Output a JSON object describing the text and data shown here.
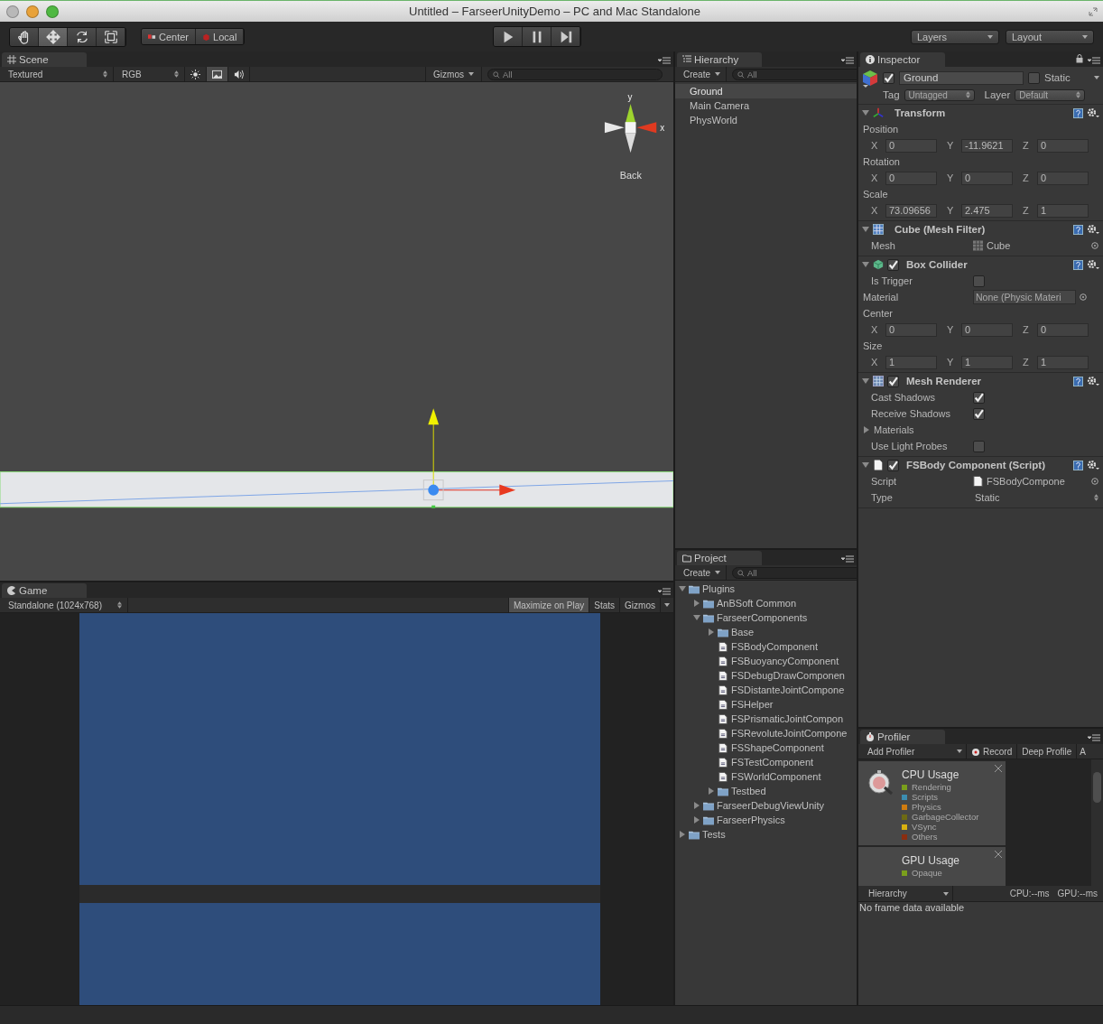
{
  "window": {
    "title": "Untitled – FarseerUnityDemo – PC and Mac Standalone"
  },
  "toolbar": {
    "tools": [
      {
        "kind": "hand",
        "selected": false
      },
      {
        "kind": "move",
        "selected": true
      },
      {
        "kind": "rotate",
        "selected": false
      },
      {
        "kind": "scale",
        "selected": false
      }
    ],
    "pivot": [
      {
        "kind": "center",
        "label": "Center"
      },
      {
        "kind": "local",
        "label": "Local"
      }
    ],
    "playback": [
      {
        "kind": "play"
      },
      {
        "kind": "pause"
      },
      {
        "kind": "step"
      }
    ],
    "layers": "Layers",
    "layout": "Layout"
  },
  "scene": {
    "tab": "Scene",
    "render_mode": "Textured",
    "color_mode": "RGB",
    "toggles": [
      {
        "kind": "lighting",
        "selected": false
      },
      {
        "kind": "image",
        "selected": true
      },
      {
        "kind": "audio",
        "selected": false
      }
    ],
    "gizmos": "Gizmos",
    "search": {
      "placeholder": "All"
    },
    "view_gizmo": {
      "y_label": "y",
      "x_label": "x",
      "view": "Back"
    }
  },
  "game": {
    "tab": "Game",
    "resolution": "Standalone (1024x768)",
    "buttons": [
      {
        "label": "Maximize on Play",
        "selected": true
      },
      {
        "label": "Stats",
        "selected": false
      },
      {
        "label": "Gizmos",
        "selected": false
      }
    ]
  },
  "hierarchy": {
    "tab": "Hierarchy",
    "create": "Create",
    "search": {
      "placeholder": "All"
    },
    "items": [
      {
        "label": "Ground",
        "selected": true
      },
      {
        "label": "Main Camera",
        "selected": false
      },
      {
        "label": "PhysWorld",
        "selected": false
      }
    ]
  },
  "inspector": {
    "tab": "Inspector",
    "object": {
      "name": "Ground",
      "active": true,
      "static": false,
      "static_label": "Static",
      "tag_label": "Tag",
      "tag": "Untagged",
      "layer_label": "Layer",
      "layer": "Default"
    },
    "components": [
      {
        "kind": "transform",
        "title": "Transform",
        "expanded": true,
        "rows": [
          {
            "kind": "heading",
            "label": "Position"
          },
          {
            "kind": "vector",
            "fields": [
              {
                "axis": "X",
                "value": "0"
              },
              {
                "axis": "Y",
                "value": "-11.9621"
              },
              {
                "axis": "Z",
                "value": "0"
              }
            ]
          },
          {
            "kind": "heading",
            "label": "Rotation"
          },
          {
            "kind": "vector",
            "fields": [
              {
                "axis": "X",
                "value": "0"
              },
              {
                "axis": "Y",
                "value": "0"
              },
              {
                "axis": "Z",
                "value": "0"
              }
            ]
          },
          {
            "kind": "heading",
            "label": "Scale"
          },
          {
            "kind": "vector",
            "fields": [
              {
                "axis": "X",
                "value": "73.09656"
              },
              {
                "axis": "Y",
                "value": "2.475"
              },
              {
                "axis": "Z",
                "value": "1"
              }
            ]
          }
        ]
      },
      {
        "kind": "mesh-filter",
        "title": "Cube (Mesh Filter)",
        "expanded": true,
        "rows": [
          {
            "kind": "mesh-ref",
            "label": "Mesh",
            "value": "Cube"
          }
        ]
      },
      {
        "kind": "box-collider",
        "title": "Box Collider",
        "enabled": true,
        "expanded": true,
        "rows": [
          {
            "kind": "toggle",
            "label": "Is Trigger",
            "checked": false
          },
          {
            "kind": "asset-field",
            "label": "Material",
            "value": "None (Physic Materi"
          },
          {
            "kind": "heading",
            "label": "Center"
          },
          {
            "kind": "vector",
            "fields": [
              {
                "axis": "X",
                "value": "0"
              },
              {
                "axis": "Y",
                "value": "0"
              },
              {
                "axis": "Z",
                "value": "0"
              }
            ]
          },
          {
            "kind": "heading",
            "label": "Size"
          },
          {
            "kind": "vector",
            "fields": [
              {
                "axis": "X",
                "value": "1"
              },
              {
                "axis": "Y",
                "value": "1"
              },
              {
                "axis": "Z",
                "value": "1"
              }
            ]
          }
        ]
      },
      {
        "kind": "mesh-renderer",
        "title": "Mesh Renderer",
        "enabled": true,
        "expanded": true,
        "rows": [
          {
            "kind": "toggle",
            "label": "Cast Shadows",
            "checked": true
          },
          {
            "kind": "toggle",
            "label": "Receive Shadows",
            "checked": true
          },
          {
            "kind": "foldout",
            "label": "Materials",
            "expanded": false
          },
          {
            "kind": "toggle",
            "label": "Use Light Probes",
            "checked": false
          }
        ]
      },
      {
        "kind": "script",
        "title": "FSBody Component (Script)",
        "enabled": true,
        "expanded": true,
        "rows": [
          {
            "kind": "script-ref",
            "label": "Script",
            "value": "FSBodyCompone"
          },
          {
            "kind": "enum",
            "label": "Type",
            "value": "Static"
          }
        ]
      }
    ]
  },
  "project": {
    "tab": "Project",
    "create": "Create",
    "search": {
      "placeholder": "All"
    },
    "tree": [
      {
        "kind": "folder",
        "label": "Plugins",
        "expanded": true,
        "children": [
          {
            "kind": "folder",
            "label": "AnBSoft Common",
            "expanded": false
          },
          {
            "kind": "folder",
            "label": "FarseerComponents",
            "expanded": true,
            "children": [
              {
                "kind": "folder",
                "label": "Base",
                "expanded": false
              },
              {
                "kind": "script",
                "label": "FSBodyComponent"
              },
              {
                "kind": "script",
                "label": "FSBuoyancyComponent"
              },
              {
                "kind": "script",
                "label": "FSDebugDrawComponen"
              },
              {
                "kind": "script",
                "label": "FSDistanteJointCompone"
              },
              {
                "kind": "script",
                "label": "FSHelper"
              },
              {
                "kind": "script",
                "label": "FSPrismaticJointCompon"
              },
              {
                "kind": "script",
                "label": "FSRevoluteJointCompone"
              },
              {
                "kind": "script",
                "label": "FSShapeComponent"
              },
              {
                "kind": "script",
                "label": "FSTestComponent"
              },
              {
                "kind": "script",
                "label": "FSWorldComponent"
              },
              {
                "kind": "folder",
                "label": "Testbed",
                "expanded": false
              }
            ]
          },
          {
            "kind": "folder",
            "label": "FarseerDebugViewUnity",
            "expanded": false
          },
          {
            "kind": "folder",
            "label": "FarseerPhysics",
            "expanded": false
          }
        ]
      },
      {
        "kind": "folder",
        "label": "Tests",
        "expanded": false
      }
    ]
  },
  "profiler": {
    "tab": "Profiler",
    "add_profiler": "Add Profiler",
    "record": {
      "label": "Record",
      "selected": false
    },
    "deep_profile": "Deep Profile",
    "more": "A",
    "areas": [
      {
        "kind": "cpu",
        "title": "CPU Usage",
        "legend": [
          {
            "label": "Rendering",
            "color": "#7a9f1c"
          },
          {
            "label": "Scripts",
            "color": "#3c8db0"
          },
          {
            "label": "Physics",
            "color": "#d07c10"
          },
          {
            "label": "GarbageCollector",
            "color": "#6e6a14"
          },
          {
            "label": "VSync",
            "color": "#d8b010"
          },
          {
            "label": "Others",
            "color": "#8a2e10"
          }
        ]
      },
      {
        "kind": "gpu",
        "title": "GPU Usage",
        "legend": [
          {
            "label": "Opaque",
            "color": "#7a9f1c"
          }
        ]
      }
    ],
    "view": "Hierarchy",
    "cpu_time": "CPU:--ms",
    "gpu_time": "GPU:--ms",
    "message": "No frame data available"
  }
}
